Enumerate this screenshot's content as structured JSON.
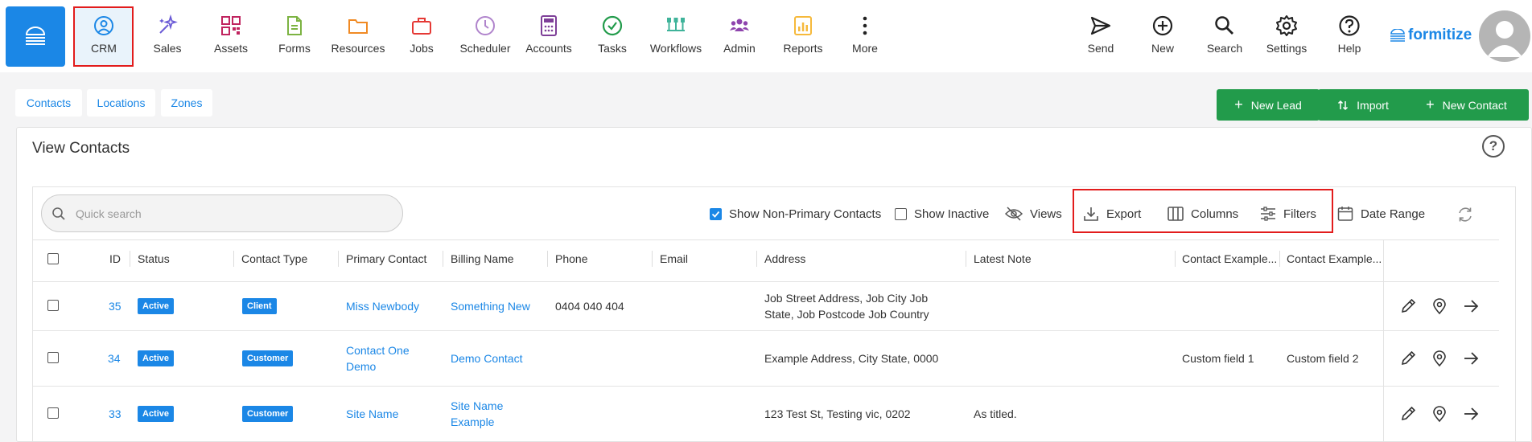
{
  "nav": {
    "items": [
      {
        "label": "CRM",
        "icon": "user-circle-icon",
        "color": "#1b87e6"
      },
      {
        "label": "Sales",
        "icon": "sparkle-icon",
        "color": "#6b5bd6"
      },
      {
        "label": "Assets",
        "icon": "qr-code-icon",
        "color": "#c0245f"
      },
      {
        "label": "Forms",
        "icon": "document-icon",
        "color": "#7cb342"
      },
      {
        "label": "Resources",
        "icon": "folder-icon",
        "color": "#f08a24"
      },
      {
        "label": "Jobs",
        "icon": "briefcase-icon",
        "color": "#e53935"
      },
      {
        "label": "Scheduler",
        "icon": "clock-icon",
        "color": "#b084cc"
      },
      {
        "label": "Accounts",
        "icon": "calculator-icon",
        "color": "#7e3f98"
      },
      {
        "label": "Tasks",
        "icon": "check-circle-icon",
        "color": "#229b4b"
      },
      {
        "label": "Workflows",
        "icon": "workflow-icon",
        "color": "#3fb39a"
      },
      {
        "label": "Admin",
        "icon": "users-icon",
        "color": "#8e44ad"
      },
      {
        "label": "Reports",
        "icon": "bar-chart-icon",
        "color": "#f6b93b"
      },
      {
        "label": "More",
        "icon": "more-vertical-icon",
        "color": "#222222"
      }
    ],
    "right_items": [
      {
        "label": "Send",
        "icon": "send-icon"
      },
      {
        "label": "New",
        "icon": "plus-circle-icon"
      },
      {
        "label": "Search",
        "icon": "search-icon"
      },
      {
        "label": "Settings",
        "icon": "gear-icon"
      },
      {
        "label": "Help",
        "icon": "help-circle-icon"
      }
    ],
    "brand": "formitize",
    "accent": "#1b87e6"
  },
  "subtabs": [
    "Contacts",
    "Locations",
    "Zones"
  ],
  "actions": {
    "new_lead": "New Lead",
    "import": "Import",
    "new_contact": "New Contact",
    "color": "#229b4b"
  },
  "panel": {
    "title": "View Contacts",
    "help": "?"
  },
  "toolbar": {
    "search_placeholder": "Quick search",
    "show_non_primary": "Show Non-Primary Contacts",
    "show_non_primary_checked": true,
    "show_inactive": "Show Inactive",
    "show_inactive_checked": false,
    "views": "Views",
    "export": "Export",
    "columns": "Columns",
    "filters": "Filters",
    "date_range": "Date Range"
  },
  "table": {
    "headers": [
      "ID",
      "Status",
      "Contact Type",
      "Primary Contact",
      "Billing Name",
      "Phone",
      "Email",
      "Address",
      "Latest Note",
      "Contact Example...",
      "Contact Example..."
    ],
    "rows": [
      {
        "id": "35",
        "status": "Active",
        "contact_type": "Client",
        "primary_contact": [
          "Miss Newbody"
        ],
        "billing_name": [
          "Something New"
        ],
        "phone": "0404 040 404",
        "email": "",
        "address": [
          "Job Street Address, Job City Job",
          "State, Job Postcode Job Country"
        ],
        "latest_note": "",
        "custom1": "",
        "custom2": ""
      },
      {
        "id": "34",
        "status": "Active",
        "contact_type": "Customer",
        "primary_contact": [
          "Contact One",
          "Demo"
        ],
        "billing_name": [
          "Demo Contact"
        ],
        "phone": "",
        "email": "",
        "address": [
          "Example Address, City State, 0000"
        ],
        "latest_note": "",
        "custom1": "Custom field 1",
        "custom2": "Custom field 2"
      },
      {
        "id": "33",
        "status": "Active",
        "contact_type": "Customer",
        "primary_contact": [
          "Site Name"
        ],
        "billing_name": [
          "Site Name",
          "Example"
        ],
        "phone": "",
        "email": "",
        "address": [
          "123 Test St, Testing vic, 0202"
        ],
        "latest_note": "As titled.",
        "custom1": "",
        "custom2": ""
      }
    ],
    "row_actions": [
      "pencil-icon",
      "map-pin-icon",
      "arrow-right-icon"
    ]
  }
}
